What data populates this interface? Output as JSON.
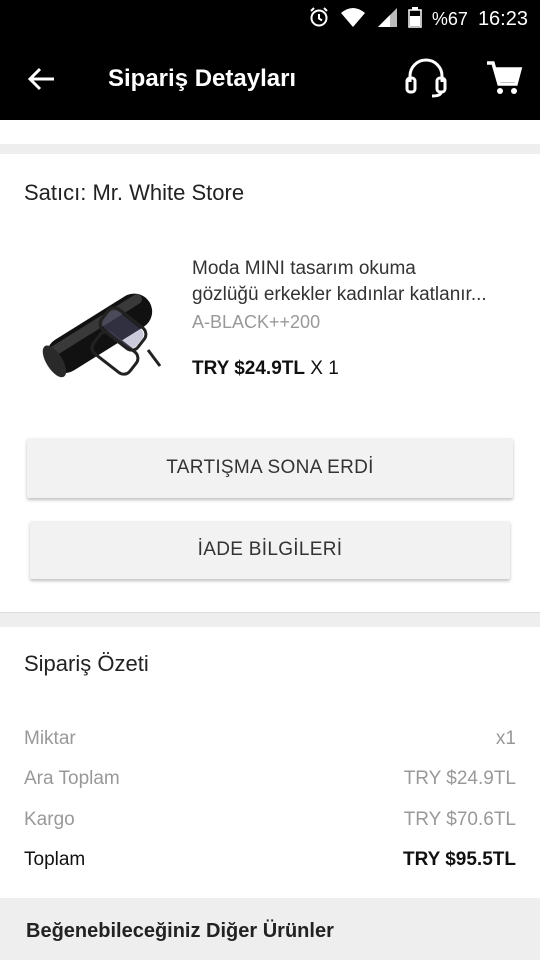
{
  "status_bar": {
    "battery": "%67",
    "time": "16:23",
    "icons": [
      "alarm-icon",
      "wifi-icon",
      "signal-icon",
      "battery-icon"
    ]
  },
  "app_bar": {
    "title": "Sipariş Detayları",
    "icons": [
      "back-arrow-icon",
      "headset-icon",
      "cart-icon"
    ]
  },
  "seller": {
    "label": "Satıcı: Mr. White Store"
  },
  "product": {
    "title_line1": "Moda MINI tasarım okuma",
    "title_line2": "gözlüğü erkekler kadınlar katlanır...",
    "variant": "A-BLACK++200",
    "price": "TRY $24.9TL",
    "quantity": "X 1"
  },
  "buttons": {
    "dispute": "TARTIŞMA SONA ERDİ",
    "return_info": "İADE BİLGİLERİ"
  },
  "summary": {
    "title": "Sipariş Özeti",
    "rows": [
      {
        "label": "Miktar",
        "value": "x1"
      },
      {
        "label": "Ara Toplam",
        "value": "TRY $24.9TL"
      },
      {
        "label": "Kargo",
        "value": "TRY $70.6TL"
      },
      {
        "label": "Toplam",
        "value": "TRY $95.5TL"
      }
    ]
  },
  "recommendations": {
    "title": "Beğenebileceğiniz Diğer Ürünler"
  },
  "colors": {
    "bar": "#000000",
    "button_bg": "#f2f2f2",
    "muted_text": "#999999"
  }
}
